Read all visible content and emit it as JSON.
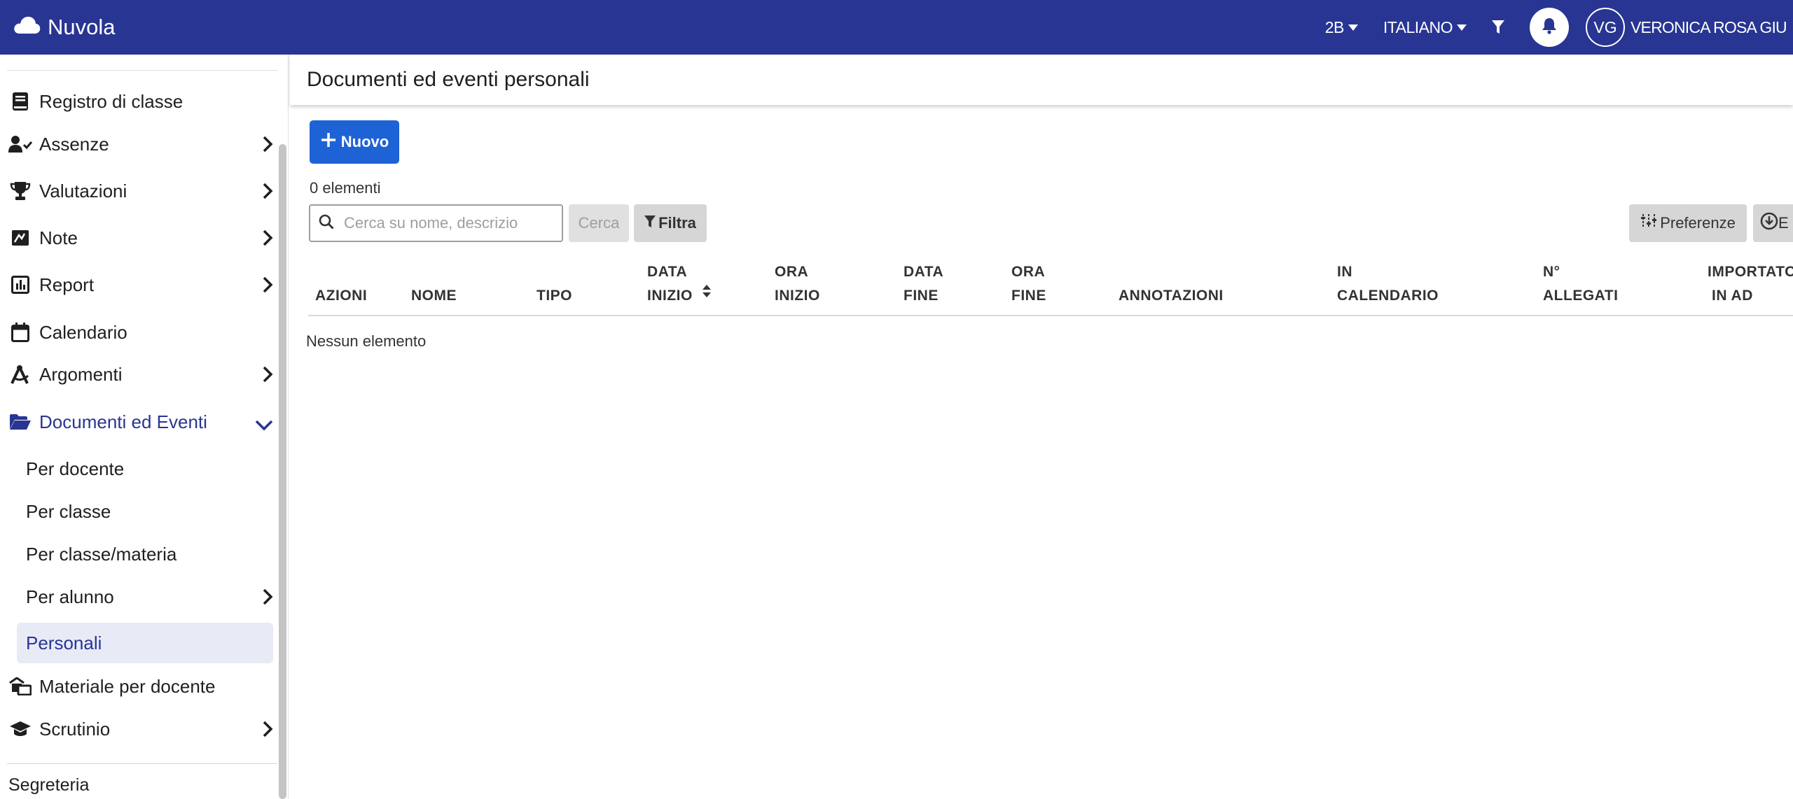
{
  "app": {
    "title": "Nuvola"
  },
  "topbar": {
    "class_selector": "2B",
    "language": "ITALIANO",
    "user_initials": "VG",
    "user_name": "VERONICA ROSA GIU"
  },
  "sidebar": {
    "items": [
      {
        "label": "Registro di classe",
        "icon": "book-icon",
        "has_chevron": false
      },
      {
        "label": "Assenze",
        "icon": "user-check-icon",
        "has_chevron": true
      },
      {
        "label": "Valutazioni",
        "icon": "trophy-icon",
        "has_chevron": true
      },
      {
        "label": "Note",
        "icon": "note-icon",
        "has_chevron": true
      },
      {
        "label": "Report",
        "icon": "report-icon",
        "has_chevron": true
      },
      {
        "label": "Calendario",
        "icon": "calendar-icon",
        "has_chevron": false
      },
      {
        "label": "Argomenti",
        "icon": "compass-icon",
        "has_chevron": true
      },
      {
        "label": "Documenti ed Eventi",
        "icon": "folder-open-icon",
        "has_chevron": true,
        "expanded": true
      }
    ],
    "subitems": [
      {
        "label": "Per docente"
      },
      {
        "label": "Per classe"
      },
      {
        "label": "Per classe/materia"
      },
      {
        "label": "Per alunno",
        "has_chevron": true
      },
      {
        "label": "Personali",
        "active": true
      }
    ],
    "items_after": [
      {
        "label": "Materiale per docente",
        "icon": "materials-icon",
        "has_chevron": false
      },
      {
        "label": "Scrutinio",
        "icon": "graduation-cap-icon",
        "has_chevron": true
      }
    ],
    "section": "Segreteria"
  },
  "main": {
    "page_title": "Documenti ed eventi personali",
    "new_button": "Nuovo",
    "count_text": "0 elementi",
    "search_placeholder": "Cerca su nome, descrizio",
    "search_button": "Cerca",
    "filter_button": "Filtra",
    "preferences_button": "Preferenze",
    "export_button": "E",
    "columns": {
      "azioni": "AZIONI",
      "nome": "NOME",
      "tipo": "TIPO",
      "data_inizio_1": "DATA",
      "data_inizio_2": "INIZIO",
      "ora_inizio_1": "ORA",
      "ora_inizio_2": "INIZIO",
      "data_fine_1": "DATA",
      "data_fine_2": "FINE",
      "ora_fine_1": "ORA",
      "ora_fine_2": "FINE",
      "annotazioni": "ANNOTAZIONI",
      "in_calendario_1": "IN",
      "in_calendario_2": "CALENDARIO",
      "allegati_1": "N°",
      "allegati_2": "ALLEGATI",
      "importato_1": "IMPORTATO",
      "importato_2": "IN AD"
    },
    "empty_text": "Nessun elemento"
  },
  "colors": {
    "topbar": "#283593",
    "primary_button": "#1e63d6",
    "active_nav": "#283593",
    "active_bg": "#e8eaf6"
  }
}
